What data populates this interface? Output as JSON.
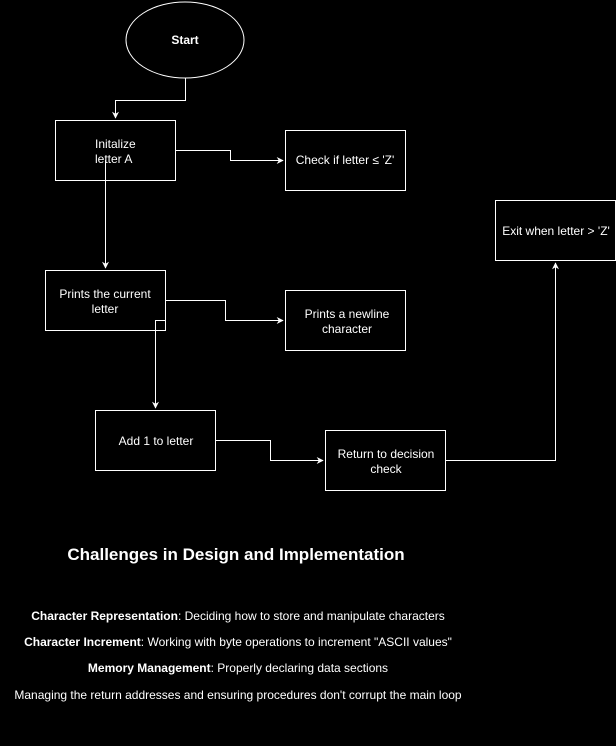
{
  "colors": {
    "background": "#000000",
    "stroke": "#ffffff",
    "text": "#ffffff"
  },
  "flowchart": {
    "start": "Start",
    "init_line1": "Initalize",
    "init_line2": "letter A",
    "check": "Check if letter ≤ 'Z'",
    "print_line1": "Prints the current",
    "print_line2": "letter",
    "newline_line1": "Prints a newline",
    "newline_line2": "character",
    "add": "Add 1 to letter",
    "return_line1": "Return to decision",
    "return_line2": "check",
    "exit": "Exit when letter > 'Z'"
  },
  "challenges": {
    "title": "Challenges in Design and Implementation",
    "items": [
      {
        "label": "Character Representation",
        "text": ": Deciding how to store and manipulate characters"
      },
      {
        "label": "Character Increment",
        "text": ": Working with byte operations to increment \"ASCII values\""
      },
      {
        "label": "Memory Management",
        "text": ": Properly declaring data sections"
      },
      {
        "label": "",
        "text": "Managing the return addresses and ensuring procedures don't corrupt the main loop"
      }
    ]
  }
}
